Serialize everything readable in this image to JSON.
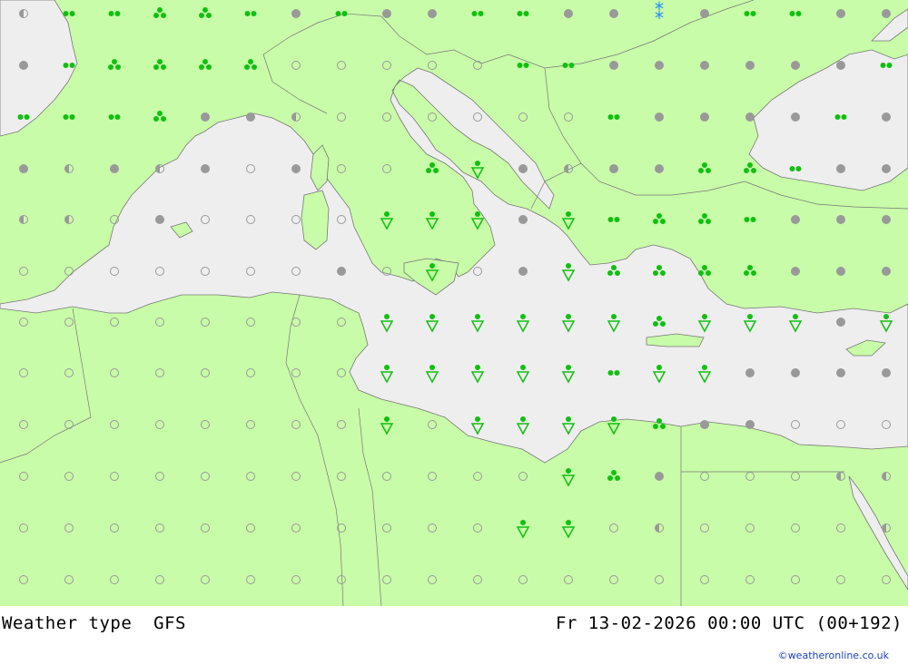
{
  "footer": {
    "title": "Weather type",
    "model": "GFS",
    "datetime": "Fr 13-02-2026 00:00 UTC (00+192)"
  },
  "credit": "©weatheronline.co.uk",
  "colors": {
    "land": "#c8fca8",
    "sea": "#eeeeee",
    "border": "#888888",
    "symbol_green": "#10c010",
    "symbol_grey": "#999999",
    "snow_blue": "#1a8cff"
  },
  "legend_symbols": {
    "cloud_empty": "open circle",
    "cloud_half": "half-filled circle",
    "cloud_full": "filled grey circle",
    "rain_dots": "two green dots",
    "rain_three": "three green dots",
    "shower": "green triangle with dot",
    "snow": "blue asterisks"
  },
  "grid": {
    "columns": [
      26,
      76,
      126,
      176,
      226,
      276,
      326,
      376,
      426,
      476,
      526,
      576,
      626,
      676,
      726,
      776,
      826,
      876,
      926,
      976
    ],
    "rows": [
      15,
      72,
      129,
      186,
      242,
      299,
      355,
      411,
      468,
      525,
      582,
      639
    ],
    "symbols": [
      "h_r_r_t_t_r_f_r_f_f_r_r_f_f_s_f_r_r_f_f",
      "f_r_t_t_t_t_e_e_e_e_e_r_r_f_f_f_f_f_f_r",
      "r_r_r_t_f_f_h_e_e_e_e_e_e_r_f_f_f_f_r_f",
      "f_h_f_h_f_e_f_e_e_t_v_f_h_f_f_t_t_r_f_f",
      "h_h_e_f_e_e_e_e_v_v_v_f_v_r_t_t_r_f_f_f",
      "e_e_e_e_e_e_e_f_e_v_e_f_v_t_t_t_t_f_f_f",
      "e_e_e_e_e_e_e_e_v_v_v_v_v_v_t_v_v_v_f_v",
      "e_e_e_e_e_e_e_e_v_v_v_v_v_r_v_v_f_f_f_f",
      "e_e_e_e_e_e_e_e_v_e_v_v_v_v_t_f_f_e_e_e",
      "e_e_e_e_e_e_e_e_e_e_e_e_v_t_f_e_e_e_h_h",
      "e_e_e_e_e_e_e_e_e_e_e_v_v_e_h_e_e_e_e_h",
      "e_e_e_e_e_e_e_e_e_e_e_e_e_e_e_e_e_e_e_e"
    ]
  }
}
